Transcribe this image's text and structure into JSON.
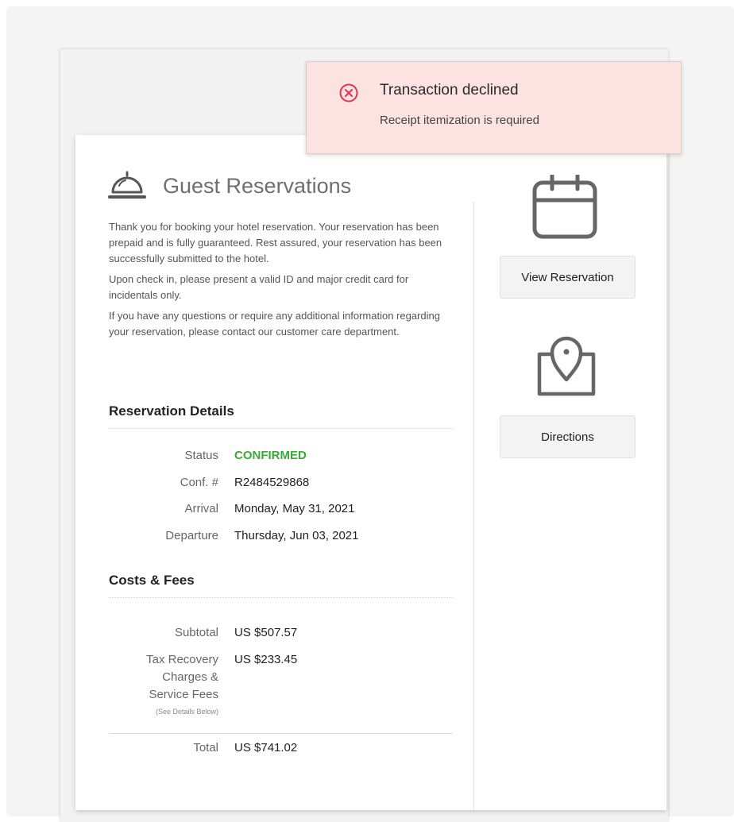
{
  "toast": {
    "title": "Transaction declined",
    "message": "Receipt itemization is required",
    "icon": "error-circle-icon",
    "color": "#e0344f"
  },
  "header": {
    "title": "Guest Reservations",
    "icon": "service-bell-icon"
  },
  "intro": {
    "p1": "Thank you for booking your hotel reservation. Your reservation has been prepaid and is fully guaranteed. Rest assured, your reservation has been successfully submitted to the hotel.",
    "p2": "Upon check in, please present a valid ID and major credit card for incidentals only.",
    "p3": "If you have any questions or require any additional information regarding your reservation, please contact our customer care department."
  },
  "details": {
    "title": "Reservation Details",
    "status_label": "Status",
    "status_value": "CONFIRMED",
    "status_color": "#3aa935",
    "conf_label": "Conf. #",
    "conf_value": "R2484529868",
    "arrival_label": "Arrival",
    "arrival_value": "Monday, May 31, 2021",
    "departure_label": "Departure",
    "departure_value": "Thursday, Jun 03, 2021"
  },
  "costs": {
    "title": "Costs & Fees",
    "subtotal_label": "Subtotal",
    "subtotal_value": "US $507.57",
    "tax_label_1": "Tax Recovery",
    "tax_label_2": "Charges &",
    "tax_label_3": "Service Fees",
    "tax_note": "(See Details Below)",
    "tax_value": "US $233.45",
    "total_label": "Total",
    "total_value": "US $741.02"
  },
  "sidebar": {
    "calendar_icon": "calendar-icon",
    "view_button": "View Reservation",
    "map_icon": "map-pin-icon",
    "directions_button": "Directions"
  }
}
